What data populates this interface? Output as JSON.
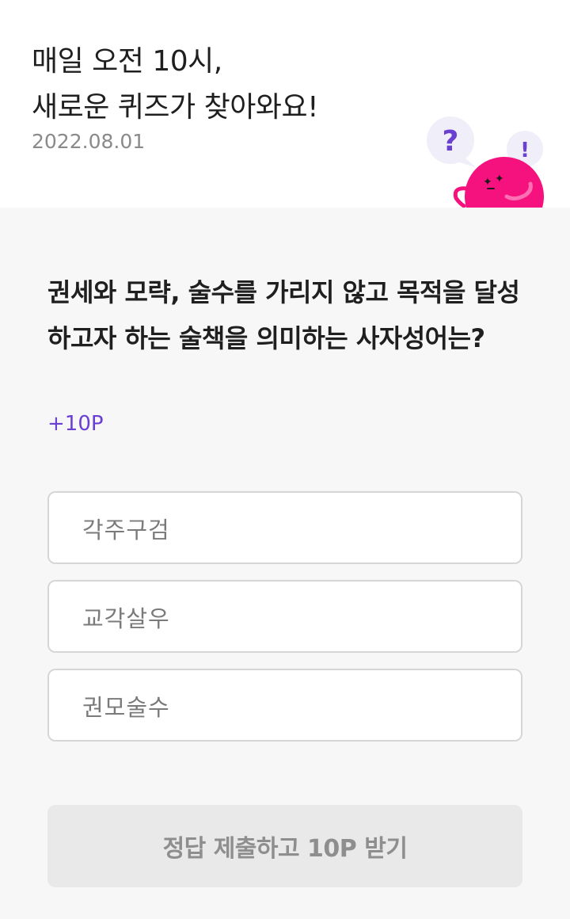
{
  "header": {
    "title_line1": "매일 오전 10시,",
    "title_line2": "새로운 퀴즈가 찾아와요!",
    "date": "2022.08.01"
  },
  "mascot": {
    "question_mark": "?",
    "exclamation": "!",
    "body_color": "#f5127f",
    "accent_color": "#6a3fd1",
    "icon": "pink-blob-mascot"
  },
  "quiz": {
    "question": "권세와 모략, 술수를 가리지 않고 목적을 달성하고자 하는 술책을 의미하는 사자성어는?",
    "points": "+10P",
    "options": [
      "각주구검",
      "교각살우",
      "권모술수"
    ],
    "submit_label": "정답 제출하고 10P 받기"
  }
}
